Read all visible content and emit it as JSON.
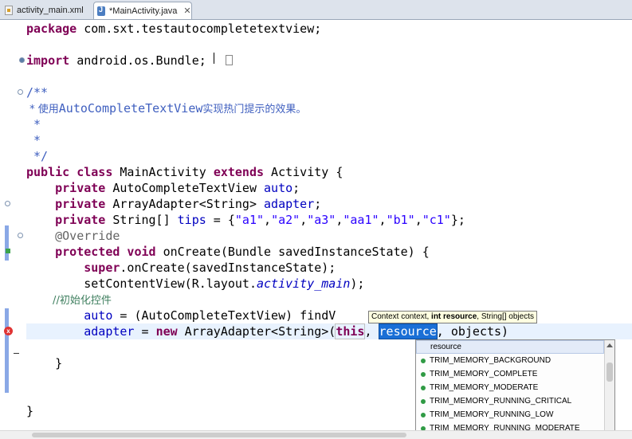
{
  "tabs": [
    {
      "label": "activity_main.xml",
      "icon": "xml-file-icon",
      "active": false
    },
    {
      "label": "*MainActivity.java",
      "icon": "java-file-icon",
      "active": true,
      "close": "✕"
    }
  ],
  "code": {
    "l1_kw": "package",
    "l1_rest": " com.sxt.testautocompletetextview;",
    "l2_kw": "import",
    "l2_rest": " android.os.Bundle;",
    "l3": "/**",
    "l4_a": " * 使用",
    "l4_b": "AutoCompleteTextView",
    "l4_c": "实现热门提示的效果。",
    "l5": " *",
    "l6": " *",
    "l7": " */",
    "l8_kw": "public class",
    "l8_mid": " MainActivity ",
    "l8_kw2": "extends",
    "l8_rest": " Activity {",
    "l9_kw": "    private",
    "l9_type": " AutoCompleteTextView ",
    "l9_fld": "auto",
    "l9_end": ";",
    "l10_kw": "    private",
    "l10_type": " ArrayAdapter<String> ",
    "l10_fld": "adapter",
    "l10_end": ";",
    "l11_kw": "    private",
    "l11_type": " String[] ",
    "l11_fld": "tips",
    "l11_eq": " = {",
    "l11_s1": "\"a1\"",
    "l11_s2": "\"a2\"",
    "l11_s3": "\"a3\"",
    "l11_s4": "\"aa1\"",
    "l11_s5": "\"b1\"",
    "l11_s6": "\"c1\"",
    "l11_comma": ",",
    "l11_end": "};",
    "l12": "    @Override",
    "l13_kw": "    protected void",
    "l13_rest": " onCreate(Bundle savedInstanceState) {",
    "l14_kw": "        super",
    "l14_rest": ".onCreate(savedInstanceState);",
    "l15_a": "        setContentView(R.layout.",
    "l15_b": "activity_main",
    "l15_c": ");",
    "l16": "        //初始化控件",
    "l17_fld": "        auto",
    "l17_rest": " = (AutoCompleteTextView) findV",
    "l18_fld": "        adapter",
    "l18_eq": " = ",
    "l18_kw": "new",
    "l18_mid": " ArrayAdapter<String>(",
    "l18_this": "this",
    "l18_sep": ", ",
    "l18_res": "resource",
    "l18_rest": ", objects)",
    "l19": "    }",
    "l20": "}"
  },
  "tooltip": {
    "a": "Context context, ",
    "b": "int resource",
    "c": ", String[] objects"
  },
  "popup": {
    "items": [
      "resource",
      "TRIM_MEMORY_BACKGROUND",
      "TRIM_MEMORY_COMPLETE",
      "TRIM_MEMORY_MODERATE",
      "TRIM_MEMORY_RUNNING_CRITICAL",
      "TRIM_MEMORY_RUNNING_LOW",
      "TRIM_MEMORY_RUNNING_MODERATE"
    ]
  },
  "colors": {
    "keyword": "#7f0055",
    "string": "#2a00ff",
    "comment": "#3f7f5f",
    "javadoc": "#3f5fbf",
    "field": "#0000c0",
    "annotation": "#646464",
    "selection": "#1a6fd6"
  }
}
